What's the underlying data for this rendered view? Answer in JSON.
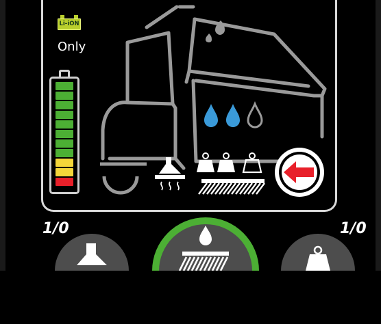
{
  "status": {
    "battery_type_badge": "Li-iON",
    "battery_type_note": "Only",
    "battery_level": {
      "filled_segments": 11,
      "total_segments": 11,
      "green_segments": 8,
      "yellow_segments": 2,
      "red_segments": 1
    }
  },
  "machine_diagram": {
    "water_flow_level": {
      "filled": 2,
      "total": 3
    },
    "brush_pressure_level": {
      "filled": 2,
      "total": 3
    }
  },
  "controls": {
    "left_counter": "1/0",
    "right_counter": "1/0"
  },
  "colors": {
    "accent_green": "#4caf34",
    "water_blue": "#3a9ad9",
    "alert_red": "#e8202a",
    "battery_green": "#4caf34",
    "battery_yellow": "#f4d63a",
    "battery_red": "#e8202a"
  },
  "icons": [
    "battery-icon",
    "scrubber-machine-icon",
    "vacuum-icon",
    "water-drop-icon",
    "weight-icon",
    "brush-icon",
    "back-arrow-icon"
  ]
}
